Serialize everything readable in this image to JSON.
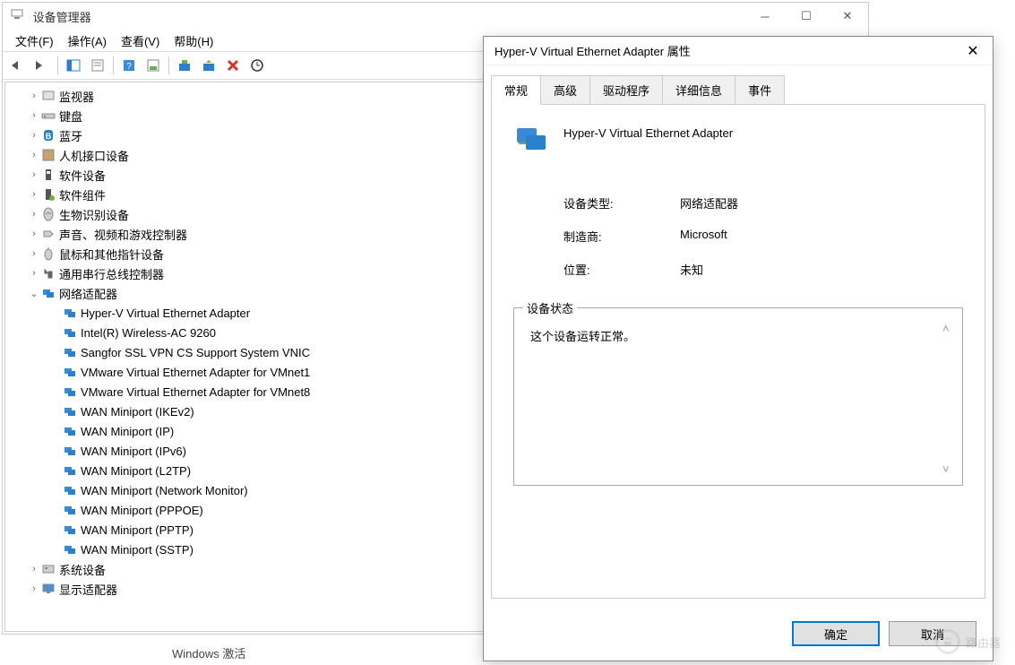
{
  "dm": {
    "title": "设备管理器",
    "menu": {
      "file": "文件(F)",
      "action": "操作(A)",
      "view": "查看(V)",
      "help": "帮助(H)"
    },
    "tree": {
      "categories": [
        {
          "label": "监视器",
          "expanded": false
        },
        {
          "label": "键盘",
          "expanded": false
        },
        {
          "label": "蓝牙",
          "expanded": false
        },
        {
          "label": "人机接口设备",
          "expanded": false
        },
        {
          "label": "软件设备",
          "expanded": false
        },
        {
          "label": "软件组件",
          "expanded": false
        },
        {
          "label": "生物识别设备",
          "expanded": false
        },
        {
          "label": "声音、视频和游戏控制器",
          "expanded": false
        },
        {
          "label": "鼠标和其他指针设备",
          "expanded": false
        },
        {
          "label": "通用串行总线控制器",
          "expanded": false
        }
      ],
      "network_label": "网络适配器",
      "adapters": [
        "Hyper-V Virtual Ethernet Adapter",
        "Intel(R) Wireless-AC 9260",
        "Sangfor SSL VPN CS Support System VNIC",
        "VMware Virtual Ethernet Adapter for VMnet1",
        "VMware Virtual Ethernet Adapter for VMnet8",
        "WAN Miniport (IKEv2)",
        "WAN Miniport (IP)",
        "WAN Miniport (IPv6)",
        "WAN Miniport (L2TP)",
        "WAN Miniport (Network Monitor)",
        "WAN Miniport (PPPOE)",
        "WAN Miniport (PPTP)",
        "WAN Miniport (SSTP)"
      ],
      "after": [
        {
          "label": "系统设备"
        },
        {
          "label": "显示适配器"
        }
      ]
    }
  },
  "props": {
    "title": "Hyper-V Virtual Ethernet Adapter 属性",
    "tabs": {
      "general": "常规",
      "advanced": "高级",
      "driver": "驱动程序",
      "details": "详细信息",
      "events": "事件"
    },
    "device_name": "Hyper-V Virtual Ethernet Adapter",
    "info": {
      "type_label": "设备类型:",
      "type_value": "网络适配器",
      "mfr_label": "制造商:",
      "mfr_value": "Microsoft",
      "loc_label": "位置:",
      "loc_value": "未知"
    },
    "status_label": "设备状态",
    "status_text": "这个设备运转正常。",
    "buttons": {
      "ok": "确定",
      "cancel": "取消"
    }
  },
  "footer": "Windows 激活",
  "watermark": "路由器"
}
